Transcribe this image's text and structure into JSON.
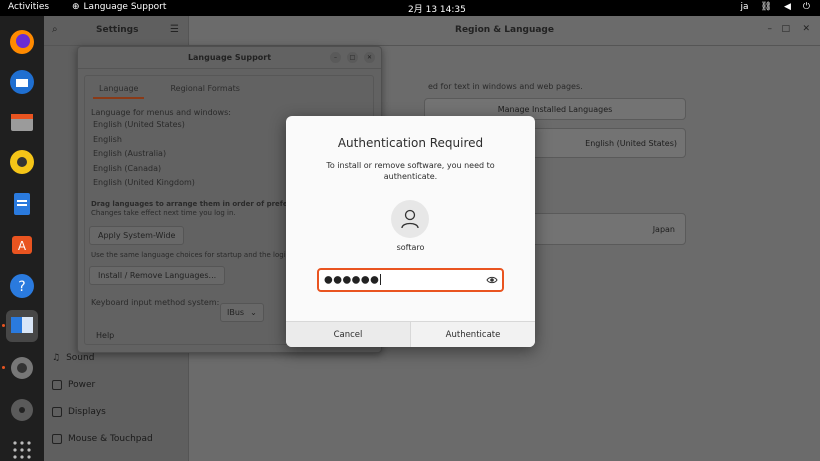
{
  "topbar": {
    "activities": "Activities",
    "app_name": "Language Support",
    "clock": "2月 13  14:35",
    "input_method": "ja"
  },
  "settings": {
    "sidebar_title": "Settings",
    "header_title": "Region & Language",
    "description": "ed for text in windows and web pages.",
    "manage_label": "Manage Installed Languages",
    "language_value": "English (United States)",
    "formats_value": "Japan",
    "sidebar_items": [
      "Sound",
      "Power",
      "Displays",
      "Mouse & Touchpad"
    ]
  },
  "language_support": {
    "title": "Language Support",
    "tabs": [
      "Language",
      "Regional Formats"
    ],
    "menus_label": "Language for menus and windows:",
    "languages": [
      "English (United States)",
      "English",
      "English (Australia)",
      "English (Canada)",
      "English (United Kingdom)"
    ],
    "drag_hint": "Drag languages to arrange them in order of preference.",
    "drag_hint2": "Changes take effect next time you log in.",
    "apply_button": "Apply System-Wide",
    "same_choices": "Use the same language choices for startup and the login sc",
    "install_button": "Install / Remove Languages...",
    "keyboard_label": "Keyboard input method system:",
    "keyboard_value": "IBus",
    "help": "Help"
  },
  "dialog": {
    "title": "Authentication Required",
    "message": "To install or remove software, you need to authenticate.",
    "username": "softaro",
    "password_masked": "●●●●●●",
    "cancel": "Cancel",
    "authenticate": "Authenticate"
  },
  "colors": {
    "accent": "#e95420"
  }
}
